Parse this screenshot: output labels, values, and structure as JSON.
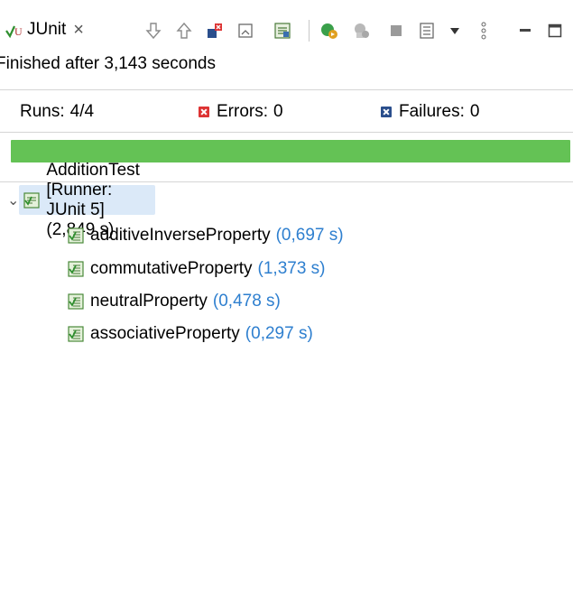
{
  "tab": {
    "title": "JUnit",
    "close": "×",
    "icon": "junit-tab-icon"
  },
  "toolbar": {
    "icons": [
      "next-failure-icon",
      "previous-failure-icon",
      "failures-only-icon",
      "scroll-lock-icon",
      "test-history-icon",
      "rerun-icon",
      "rerun-failed-first-icon",
      "stop-icon",
      "layout-icon",
      "view-menu-arrow-icon",
      "overflow-menu-icon",
      "minimize-icon",
      "maximize-icon"
    ]
  },
  "status": {
    "text": "Finished after 3,143 seconds"
  },
  "counters": {
    "runs_label": "Runs:",
    "runs_value": "4/4",
    "errors_label": "Errors:",
    "errors_value": "0",
    "failures_label": "Failures:",
    "failures_value": "0",
    "colors": {
      "errors": "#dd3333",
      "failures": "#2a4e8c"
    }
  },
  "progress": {
    "fraction": 1.0,
    "color": "#64c255"
  },
  "tree": {
    "root": {
      "label": "AdditionTest [Runner: JUnit 5] (2,849 s)",
      "expanded": true,
      "icon": "test-suite-success-icon"
    },
    "children": [
      {
        "name": "additiveInverseProperty",
        "time": "(0,697 s)",
        "icon": "test-success-icon"
      },
      {
        "name": "commutativeProperty",
        "time": "(1,373 s)",
        "icon": "test-success-icon"
      },
      {
        "name": "neutralProperty",
        "time": "(0,478 s)",
        "icon": "test-success-icon"
      },
      {
        "name": "associativeProperty",
        "time": "(0,297 s)",
        "icon": "test-success-icon"
      }
    ],
    "time_color": "#2e7fcf"
  }
}
